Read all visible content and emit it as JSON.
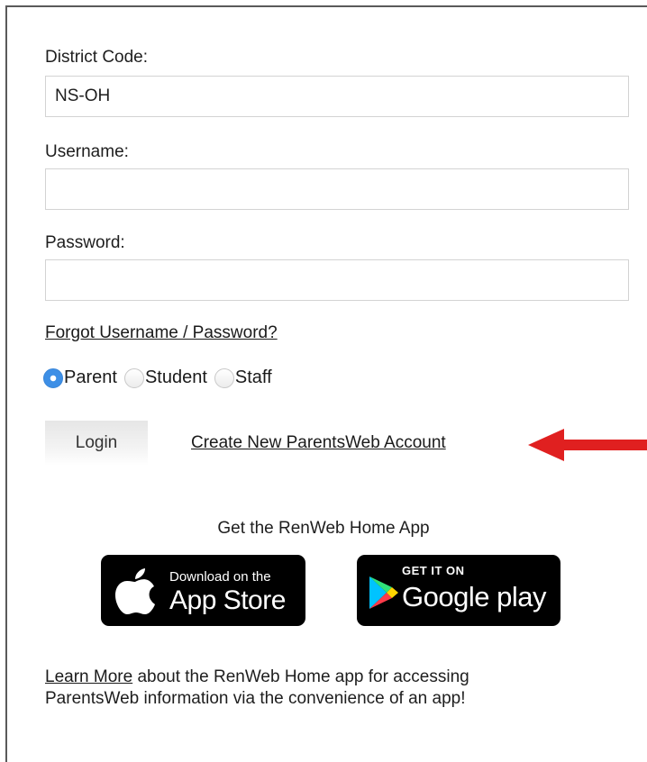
{
  "form": {
    "district_label": "District Code:",
    "district_value": "NS-OH",
    "username_label": "Username:",
    "username_value": "",
    "password_label": "Password:",
    "password_value": "",
    "forgot_link": "Forgot Username / Password?",
    "roles": [
      {
        "label": "Parent",
        "checked": true
      },
      {
        "label": "Student",
        "checked": false
      },
      {
        "label": "Staff",
        "checked": false
      }
    ],
    "login_label": "Login",
    "create_account_link": "Create New ParentsWeb Account"
  },
  "app": {
    "heading": "Get the RenWeb Home App",
    "apple_badge": {
      "small": "Download on the",
      "big": "App Store"
    },
    "google_badge": {
      "small": "GET IT ON",
      "big": "Google play"
    }
  },
  "learn_more": {
    "link": "Learn More",
    "line1_rest": " about the RenWeb Home app for accessing",
    "line2": "ParentsWeb information via the convenience of an app!"
  },
  "colors": {
    "annotation_arrow": "#e02020",
    "radio_selected": "#3d8fe6"
  }
}
